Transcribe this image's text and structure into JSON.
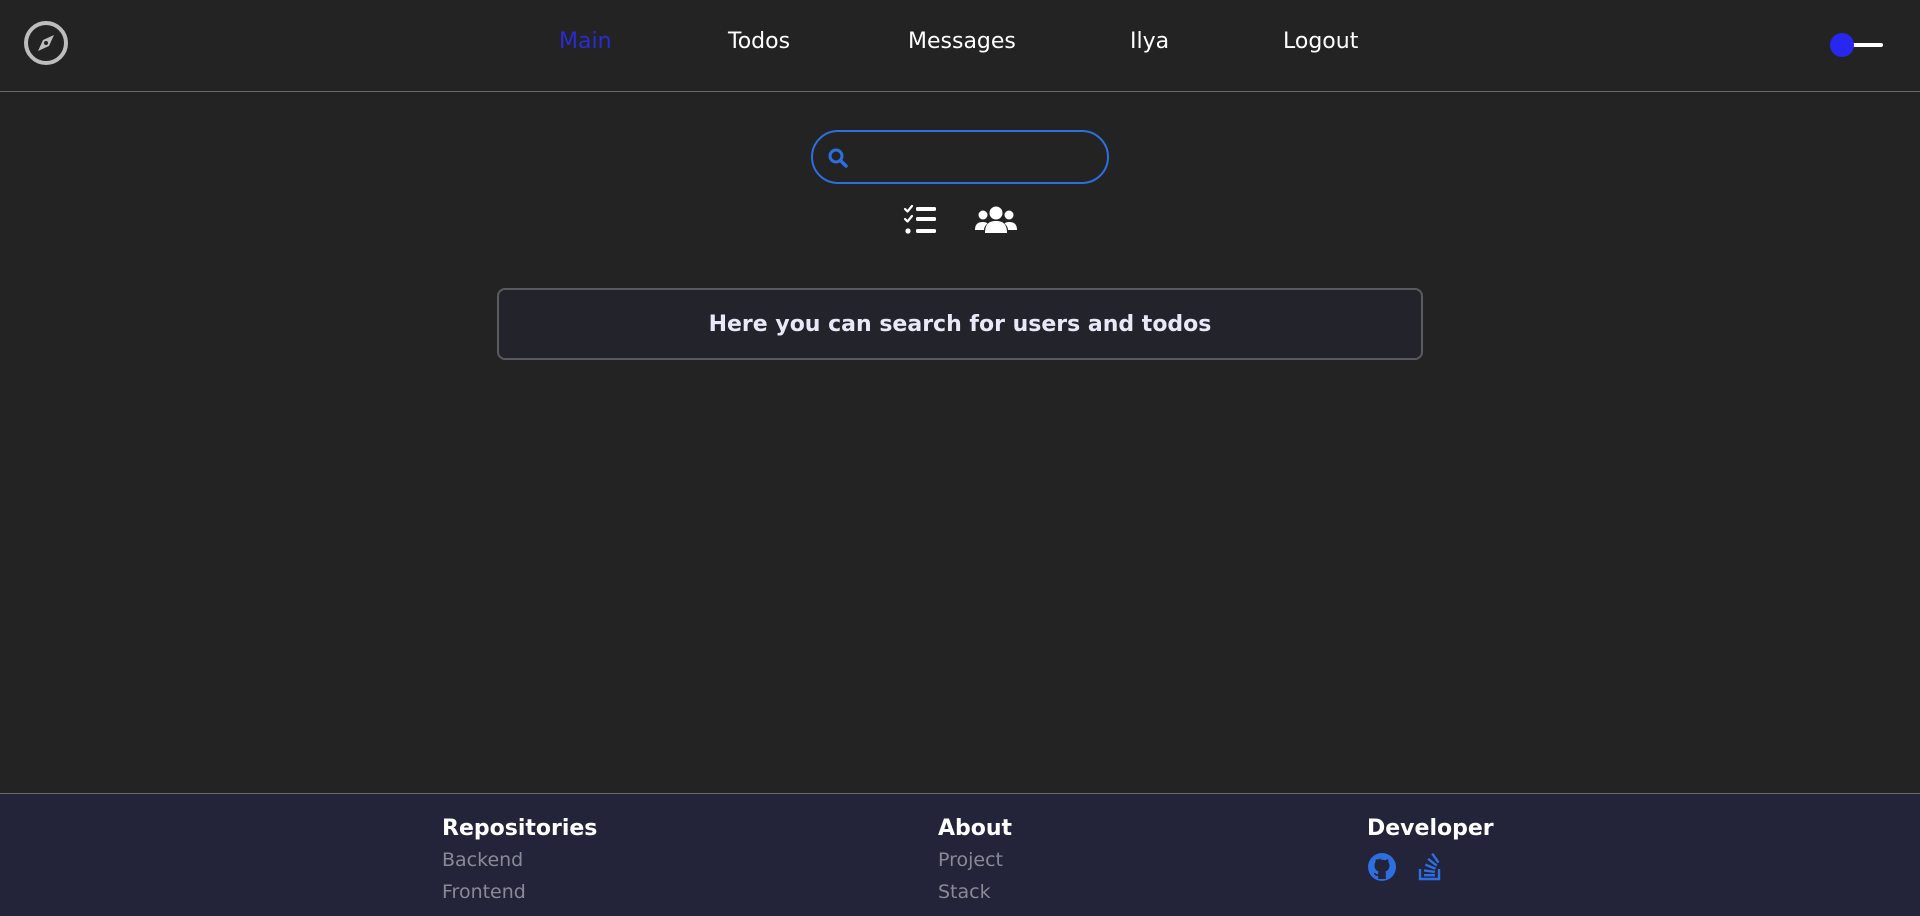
{
  "header": {
    "logo_icon": "compass-icon",
    "nav": {
      "main": "Main",
      "todos": "Todos",
      "messages": "Messages",
      "user": "Ilya",
      "logout": "Logout"
    },
    "active_nav": "Main",
    "theme_toggle_icon": "theme-toggle"
  },
  "search": {
    "placeholder": "",
    "value": "",
    "icon": "search-icon",
    "filters": [
      {
        "name": "todos",
        "icon": "checklist-icon"
      },
      {
        "name": "users",
        "icon": "users-icon"
      }
    ]
  },
  "info": {
    "text": "Here you can search for users and todos"
  },
  "footer": {
    "repositories": {
      "heading": "Repositories",
      "links": [
        "Backend",
        "Frontend"
      ]
    },
    "about": {
      "heading": "About",
      "links": [
        "Project",
        "Stack"
      ]
    },
    "developer": {
      "heading": "Developer",
      "icons": [
        "github-icon",
        "stackoverflow-icon"
      ]
    }
  },
  "colors": {
    "background": "#232323",
    "accent": "#2d6fe0",
    "active_nav": "#2b2bd6",
    "toggle_knob": "#2727f0",
    "footer_background": "#23233a"
  }
}
